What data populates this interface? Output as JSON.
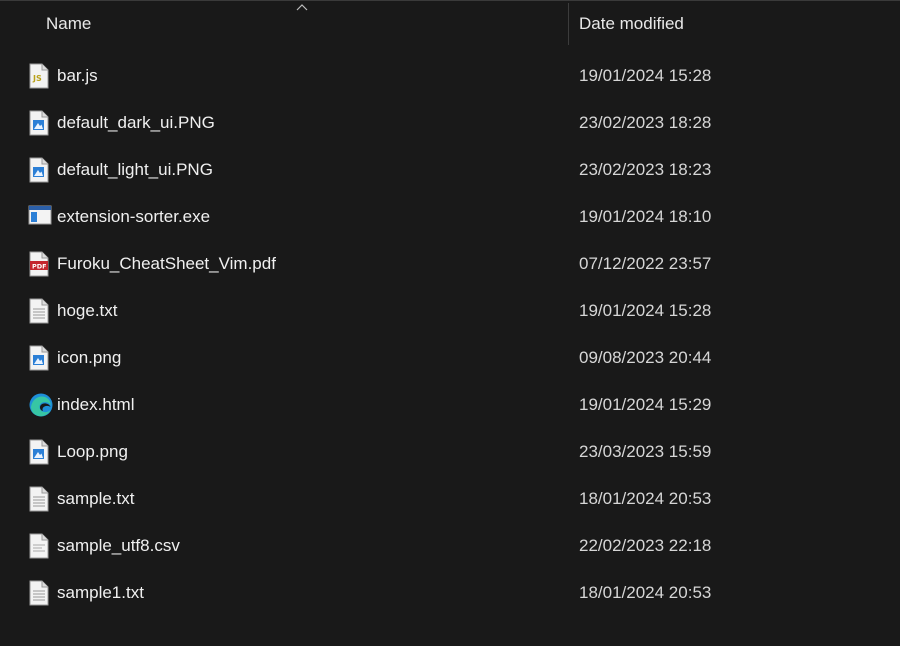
{
  "header": {
    "name_label": "Name",
    "date_label": "Date modified",
    "sort_direction": "ascending"
  },
  "files": [
    {
      "name": "bar.js",
      "date": "19/01/2024 15:28",
      "icon": "js-file-icon"
    },
    {
      "name": "default_dark_ui.PNG",
      "date": "23/02/2023 18:28",
      "icon": "image-file-icon"
    },
    {
      "name": "default_light_ui.PNG",
      "date": "23/02/2023 18:23",
      "icon": "image-file-icon"
    },
    {
      "name": "extension-sorter.exe",
      "date": "19/01/2024 18:10",
      "icon": "exe-file-icon"
    },
    {
      "name": "Furoku_CheatSheet_Vim.pdf",
      "date": "07/12/2022 23:57",
      "icon": "pdf-file-icon"
    },
    {
      "name": "hoge.txt",
      "date": "19/01/2024 15:28",
      "icon": "text-file-icon"
    },
    {
      "name": "icon.png",
      "date": "09/08/2023 20:44",
      "icon": "image-file-icon"
    },
    {
      "name": "index.html",
      "date": "19/01/2024 15:29",
      "icon": "edge-html-icon"
    },
    {
      "name": "Loop.png",
      "date": "23/03/2023 15:59",
      "icon": "image-file-icon"
    },
    {
      "name": "sample.txt",
      "date": "18/01/2024 20:53",
      "icon": "text-file-icon"
    },
    {
      "name": "sample_utf8.csv",
      "date": "22/02/2023 22:18",
      "icon": "csv-file-icon"
    },
    {
      "name": "sample1.txt",
      "date": "18/01/2024 20:53",
      "icon": "text-file-icon"
    }
  ],
  "colors": {
    "background": "#191919",
    "text": "#f0f0f0",
    "pdf_red": "#c4262e",
    "image_blue": "#2b7fd6",
    "js_yellow": "#b9a11a"
  }
}
